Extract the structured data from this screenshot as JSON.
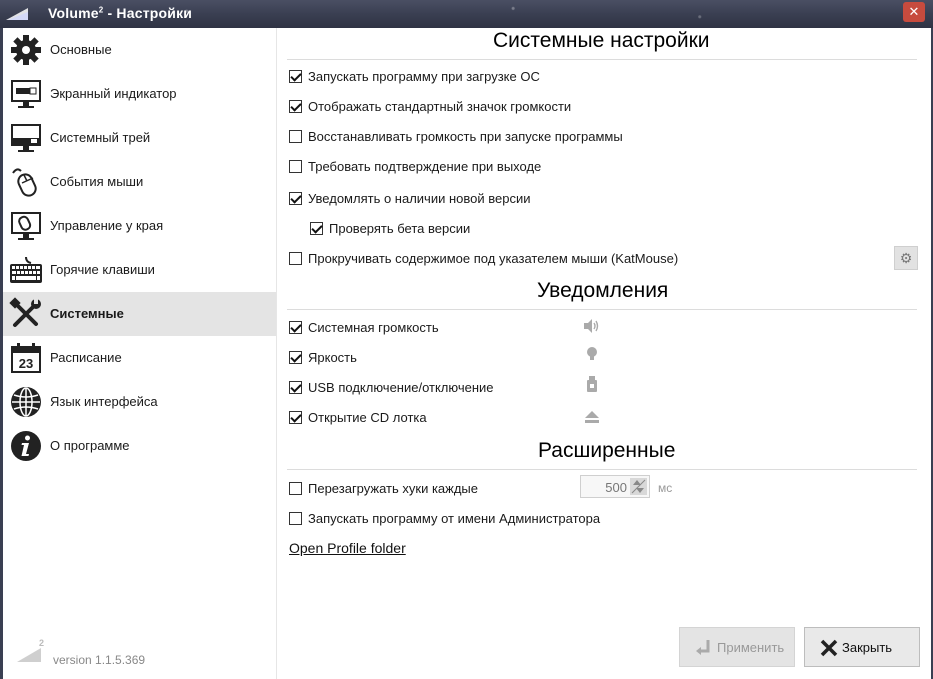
{
  "window": {
    "title": "Volume",
    "title_sup": "2",
    "title_rest": " - Настройки",
    "close_glyph": "✕"
  },
  "sidebar": {
    "items": [
      {
        "label": "Основные",
        "icon": "gear-icon"
      },
      {
        "label": "Экранный индикатор",
        "icon": "monitor-indicator-icon"
      },
      {
        "label": "Системный трей",
        "icon": "tray-icon"
      },
      {
        "label": "События мыши",
        "icon": "mouse-icon"
      },
      {
        "label": "Управление у края",
        "icon": "screen-edge-mouse-icon"
      },
      {
        "label": "Горячие клавиши",
        "icon": "keyboard-icon"
      },
      {
        "label": "Системные",
        "icon": "tools-icon",
        "active": true
      },
      {
        "label": "Расписание",
        "icon": "calendar-icon",
        "day": "23"
      },
      {
        "label": "Язык интерфейса",
        "icon": "globe-icon"
      },
      {
        "label": "О программе",
        "icon": "info-icon"
      }
    ],
    "logo_digit": "2",
    "version": "version 1.1.5.369"
  },
  "system": {
    "title": "Системные настройки",
    "options": [
      {
        "label": "Запускать программу при загрузке ОС",
        "checked": true
      },
      {
        "label": "Отображать стандартный значок громкости",
        "checked": true
      },
      {
        "label": "Восстанавливать громкость при запуске программы",
        "checked": false
      },
      {
        "label": "Требовать подтверждение при выходе",
        "checked": false
      },
      {
        "label": "Уведомлять о наличии новой версии",
        "checked": true
      },
      {
        "label": "Проверять бета версии",
        "checked": true
      },
      {
        "label": "Прокручивать содержимое под указателем мыши (KatMouse)",
        "checked": false
      }
    ],
    "gear_glyph": "⚙"
  },
  "notifications": {
    "title": "Уведомления",
    "options": [
      {
        "label": "Системная громкость",
        "checked": true,
        "icon": "speaker-icon"
      },
      {
        "label": "Яркость",
        "checked": true,
        "icon": "lightbulb-icon"
      },
      {
        "label": "USB подключение/отключение",
        "checked": true,
        "icon": "usb-drive-icon"
      },
      {
        "label": "Открытие CD лотка",
        "checked": true,
        "icon": "eject-icon"
      }
    ]
  },
  "advanced": {
    "title": "Расширенные",
    "options": [
      {
        "label": "Перезагружать хуки каждые",
        "checked": false
      },
      {
        "label": "Запускать программу от имени Администратора",
        "checked": false
      }
    ],
    "interval_value": "500",
    "interval_unit": "мс",
    "profile_link": "Open Profile folder"
  },
  "buttons": {
    "apply": "Применить",
    "close": "Закрыть"
  },
  "colors": {
    "titlebar": "#3a3f52",
    "close_button": "#c74b3e",
    "active_item": "#e4e4e4"
  }
}
